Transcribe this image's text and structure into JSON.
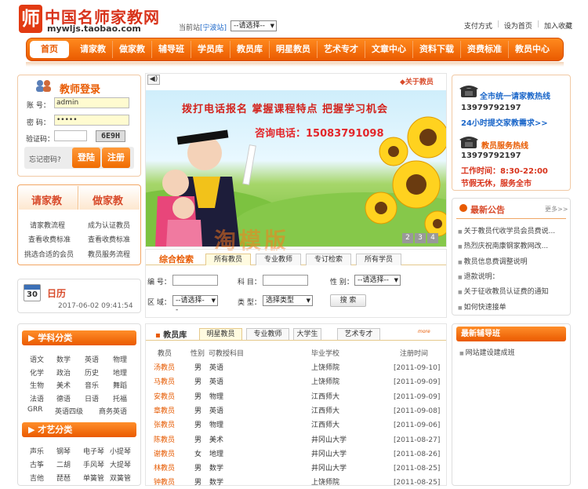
{
  "brand": {
    "logo_char": "师",
    "title": "中国名师家教网",
    "url": "mywljs.taobao.com"
  },
  "station": {
    "label": "当前站",
    "value": "[宁波站]",
    "select": "--请选择--"
  },
  "top_links": [
    "支付方式",
    "设为首页",
    "加入收藏"
  ],
  "nav": [
    "首页",
    "请家教",
    "做家教",
    "辅导班",
    "学员库",
    "教员库",
    "明星教员",
    "艺术专才",
    "文章中心",
    "资料下载",
    "资费标准",
    "教员中心"
  ],
  "login": {
    "title": "教师登录",
    "account_label": "账 号：",
    "account_value": "admin",
    "password_label": "密 码：",
    "password_value": "•••••",
    "captcha_label": "验证码：",
    "captcha_code": "6E9H",
    "forgot": "忘记密码?",
    "login_btn": "登陆",
    "register_btn": "注册"
  },
  "hire": {
    "col1_title": "请家教",
    "col2_title": "做家教",
    "col1": [
      "请家教流程",
      "查看收费标准",
      "挑选合适的会员"
    ],
    "col2": [
      "成为认证教员",
      "查看收费标准",
      "教员服务流程"
    ]
  },
  "calendar": {
    "day": "30",
    "title": "日历",
    "datetime": "2017-06-02 09:41:54"
  },
  "subjects": {
    "title": "学科分类",
    "items": [
      "语文",
      "数学",
      "英语",
      "物理",
      "化学",
      "政治",
      "历史",
      "地理",
      "生物",
      "美术",
      "音乐",
      "舞蹈",
      "法语",
      "德语",
      "日语",
      "托福",
      "GRR",
      "英语四级",
      "商务英语"
    ]
  },
  "arts": {
    "title": "才艺分类",
    "items": [
      "声乐",
      "钢琴",
      "电子琴",
      "小提琴",
      "古筝",
      "二胡",
      "手风琴",
      "大提琴",
      "吉他",
      "琵琶",
      "单簧管",
      "双簧管"
    ]
  },
  "banner": {
    "about_link": "◆关于教员",
    "headline": "拨打电话报名 掌握课程特点 把握学习机会",
    "phone": "咨询电话：15083791098",
    "pages": [
      "2",
      "3",
      "4"
    ],
    "watermark": "淘模版"
  },
  "search": {
    "title": "综合检索",
    "tabs": [
      "所有教员",
      "专业教师",
      "专订检索",
      "所有学员"
    ],
    "number_label": "编 号：",
    "subject_label": "科 目：",
    "gender_label": "性 别：",
    "gender_select": "--请选择--",
    "area_label": "区 域：",
    "area_select": "--请选择--",
    "type_label": "类 型：",
    "type_select": "选择类型",
    "search_btn": "搜 索"
  },
  "teachers": {
    "title": "教员库",
    "tabs": [
      "明星教员",
      "专业教师",
      "大学生",
      "艺术专才"
    ],
    "more": "more",
    "headers": [
      "教员",
      "性别",
      "可教授科目",
      "毕业学校",
      "注册时间"
    ],
    "rows": [
      {
        "name": "汤教员",
        "gender": "男",
        "subject": "英语",
        "school": "上饶师院",
        "date": "[2011-09-10]"
      },
      {
        "name": "马教员",
        "gender": "男",
        "subject": "英语",
        "school": "上饶师院",
        "date": "[2011-09-09]"
      },
      {
        "name": "安教员",
        "gender": "男",
        "subject": "物理",
        "school": "江西师大",
        "date": "[2011-09-09]"
      },
      {
        "name": "章教员",
        "gender": "男",
        "subject": "英语",
        "school": "江西师大",
        "date": "[2011-09-08]"
      },
      {
        "name": "张教员",
        "gender": "男",
        "subject": "物理",
        "school": "江西师大",
        "date": "[2011-09-06]"
      },
      {
        "name": "陈教员",
        "gender": "男",
        "subject": "美术",
        "school": "井冈山大学",
        "date": "[2011-08-27]"
      },
      {
        "name": "谢教员",
        "gender": "女",
        "subject": "地理",
        "school": "井冈山大学",
        "date": "[2011-08-26]"
      },
      {
        "name": "林教员",
        "gender": "男",
        "subject": "数学",
        "school": "井冈山大学",
        "date": "[2011-08-25]"
      },
      {
        "name": "钟教员",
        "gender": "男",
        "subject": "数学",
        "school": "上饶师院",
        "date": "[2011-08-25]"
      }
    ]
  },
  "hotline": {
    "line1": "全市统一请家教热线",
    "phone1": "13979792197",
    "line2": "24小时提交家教需求>>",
    "line3": "教员服务热线",
    "phone2": "13979792197",
    "hours": "工作时间：8:30-22:00",
    "slogan": "节假无休，服务全市"
  },
  "news": {
    "title": "最新公告",
    "more": "更多>>",
    "items": [
      "关于教员代收学员会员费说...",
      "热烈庆祝南康钢家教网改...",
      "教员信息费调整说明",
      "退款说明：",
      "关于征收教员认证费的通知",
      "如何快速接单"
    ]
  },
  "classes": {
    "title": "最新辅导班",
    "items": [
      "网站建设建成班"
    ]
  },
  "colors": {
    "accent": "#ea5a00",
    "brand_red": "#d8331b",
    "link_blue": "#1a66c9"
  }
}
